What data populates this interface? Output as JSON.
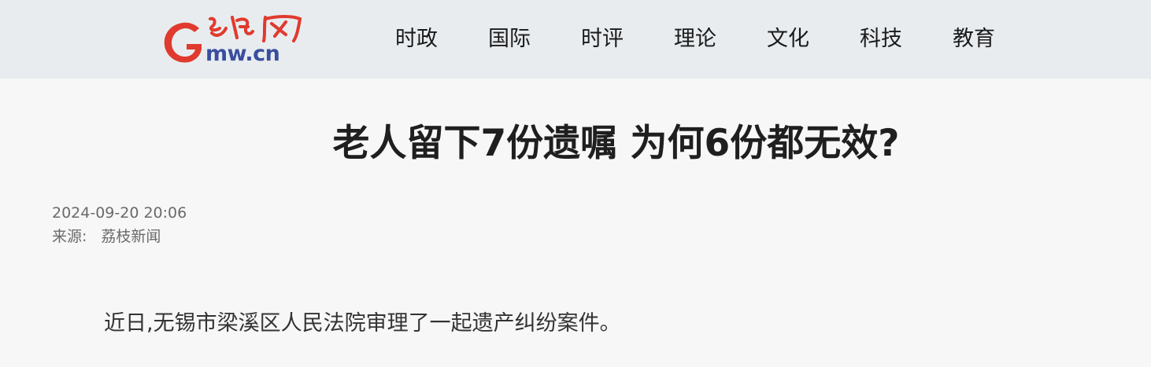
{
  "header": {
    "logo": {
      "brand_chars": "光明网",
      "letter": "G",
      "domain": "mw.cn",
      "colors": {
        "red": "#e03a2e",
        "blue": "#3a4ea0"
      }
    },
    "nav": [
      {
        "label": "时政"
      },
      {
        "label": "国际"
      },
      {
        "label": "时评"
      },
      {
        "label": "理论"
      },
      {
        "label": "文化"
      },
      {
        "label": "科技"
      },
      {
        "label": "教育"
      }
    ]
  },
  "article": {
    "title": "老人留下7份遗嘱 为何6份都无效?",
    "datetime": "2024-09-20 20:06",
    "source_label": "来源:",
    "source_name": "荔枝新闻",
    "paragraphs": [
      "近日,无锡市梁溪区人民法院审理了一起遗产纠纷案件。"
    ]
  },
  "colors": {
    "header_bg": "#e8ecef",
    "page_bg": "#f6f7f6"
  }
}
